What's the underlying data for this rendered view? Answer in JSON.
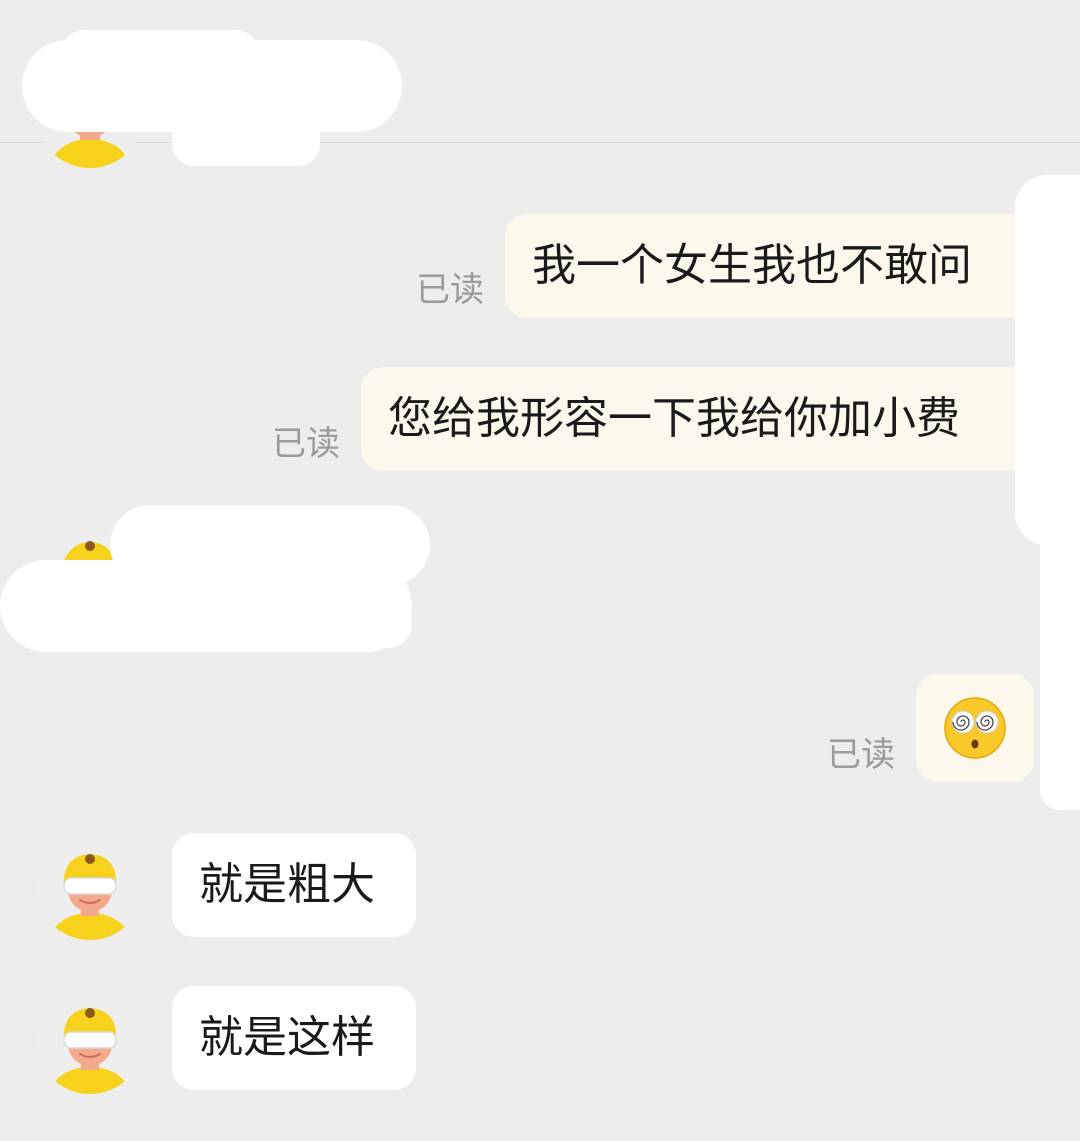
{
  "messages": {
    "m1": {
      "text": "我一个女生我也不敢问",
      "status": "已读"
    },
    "m2": {
      "text": "您给我形容一下我给你加小费",
      "status": "已读"
    },
    "m3": {
      "emoji": "dizzy-face-emoji",
      "status": "已读"
    },
    "r1": {
      "text": "就是粗大"
    },
    "r2": {
      "text": "就是这样"
    }
  },
  "colors": {
    "background": "#ededed",
    "outgoing_bubble": "#fcf8ec",
    "incoming_bubble": "#ffffff",
    "read_status": "#9a9a9a",
    "avatar_helmet": "#f7d21c"
  }
}
